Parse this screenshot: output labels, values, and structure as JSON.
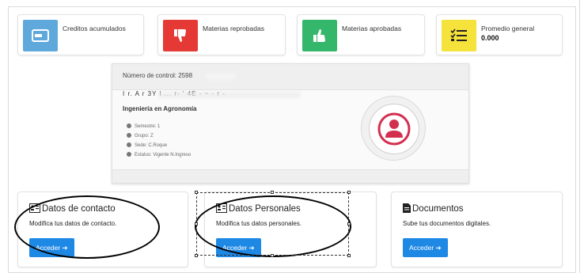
{
  "stats": [
    {
      "label": "Creditos acumulados",
      "value": "",
      "color": "#5fa8dc",
      "icon": "credit-card-icon"
    },
    {
      "label": "Materias reprobadas",
      "value": "",
      "color": "#e53935",
      "icon": "thumbs-down-icon"
    },
    {
      "label": "Materias aprobadas",
      "value": "",
      "color": "#34b76b",
      "icon": "thumbs-up-icon"
    },
    {
      "label": "Promedio general",
      "value": "0.000",
      "color": "#f5e23a",
      "icon": "checklist-icon"
    }
  ],
  "profile": {
    "control_label": "Número de control: 2598",
    "name": "I r. A r 3Y l ... r- ' 4E - ~ - r -",
    "career": "Ingeniería en Agronomía",
    "details": [
      "Semestre: 1",
      "Grupo: Z",
      "Sede: C.Roque",
      "Estatus: Vigente N.Ingreso"
    ]
  },
  "cards": [
    {
      "title": "Datos de contacto",
      "desc": "Modifica tus datos de contacto.",
      "button": "Acceder ➔",
      "icon": "contact-card-icon"
    },
    {
      "title": "Datos Personales",
      "desc": "Modifica tus datos personales.",
      "button": "Acceder ➔",
      "icon": "contact-card-icon"
    },
    {
      "title": "Documentos",
      "desc": "Sube tus documentos digitales.",
      "button": "Acceder ➔",
      "icon": "document-icon"
    }
  ],
  "colors": {
    "accent": "#1e88e5",
    "avatar": "#d32f4f"
  }
}
